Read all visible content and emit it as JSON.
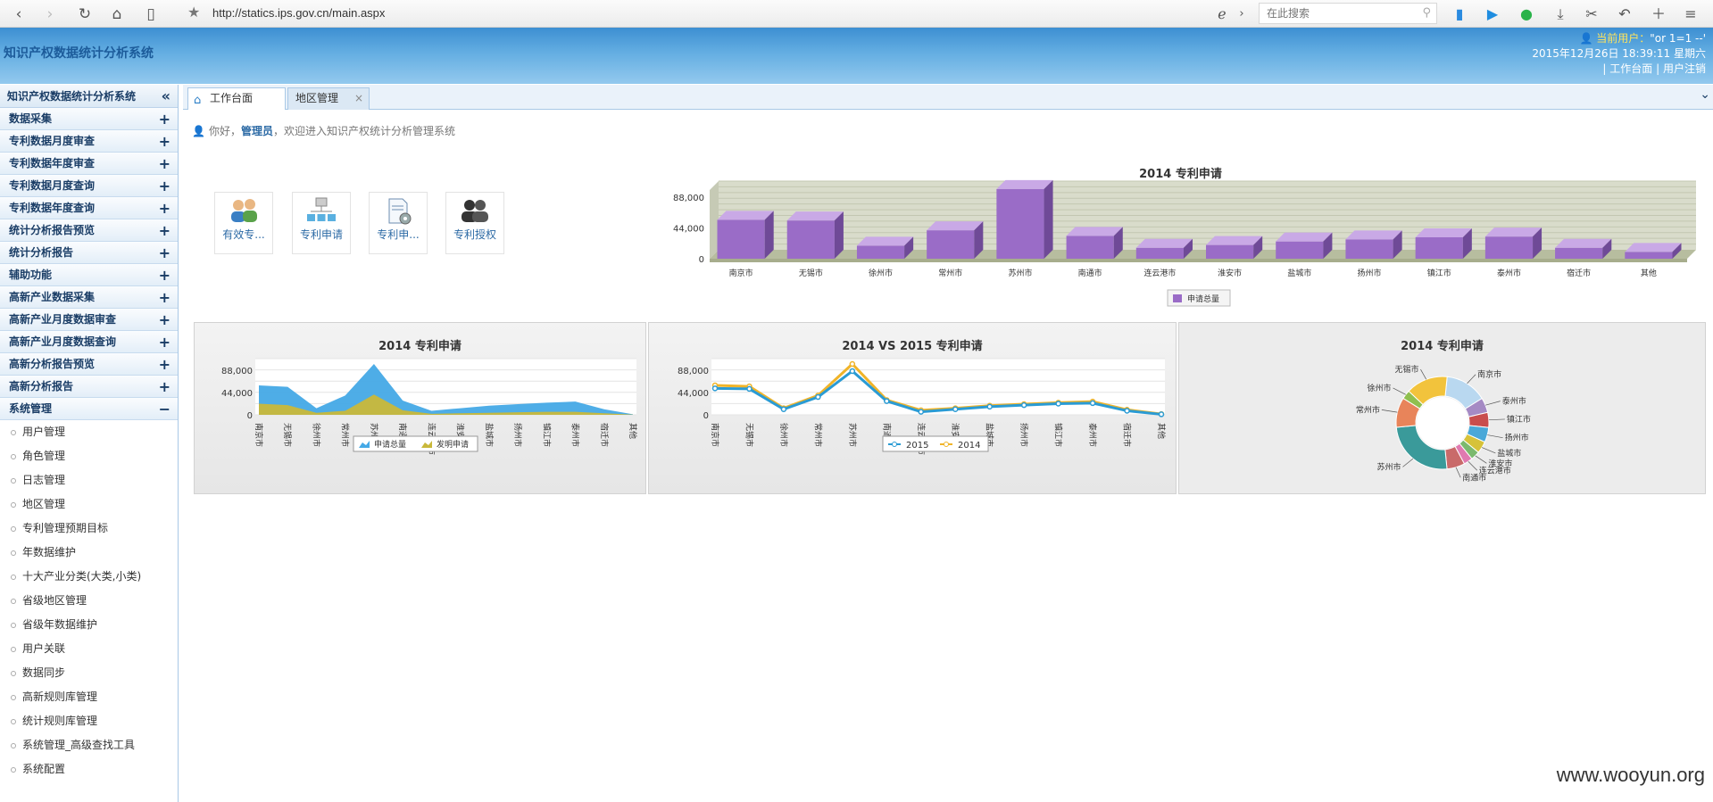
{
  "browser": {
    "url": "http://statics.ips.gov.cn/main.aspx",
    "search_placeholder": "在此搜索"
  },
  "header": {
    "title": "知识产权数据统计分析系统",
    "user_label": "当前用户：",
    "user_value": "\"or 1=1 --'",
    "datetime": "2015年12月26日 18:39:11 星期六",
    "link_home": "工作台面",
    "link_logout": "用户注销",
    "sep": "|"
  },
  "sidebar": {
    "title": "知识产权数据统计分析系统",
    "groups": [
      {
        "label": "数据采集",
        "sign": "+"
      },
      {
        "label": "专利数据月度审查",
        "sign": "+"
      },
      {
        "label": "专利数据年度审查",
        "sign": "+"
      },
      {
        "label": "专利数据月度查询",
        "sign": "+"
      },
      {
        "label": "专利数据年度查询",
        "sign": "+"
      },
      {
        "label": "统计分析报告预览",
        "sign": "+"
      },
      {
        "label": "统计分析报告",
        "sign": "+"
      },
      {
        "label": "辅助功能",
        "sign": "+"
      },
      {
        "label": "高新产业数据采集",
        "sign": "+"
      },
      {
        "label": "高新产业月度数据审查",
        "sign": "+"
      },
      {
        "label": "高新产业月度数据查询",
        "sign": "+"
      },
      {
        "label": "高新分析报告预览",
        "sign": "+"
      },
      {
        "label": "高新分析报告",
        "sign": "+"
      },
      {
        "label": "系统管理",
        "sign": "−"
      }
    ],
    "sub_items": [
      "用户管理",
      "角色管理",
      "日志管理",
      "地区管理",
      "专利管理预期目标",
      "年数据维护",
      "十大产业分类(大类,小类)",
      "省级地区管理",
      "省级年数据维护",
      "用户关联",
      "数据同步",
      "高新规则库管理",
      "统计规则库管理",
      "系统管理_高级查找工具",
      "系统配置"
    ]
  },
  "tabs": {
    "home": "工作台面",
    "region": "地区管理",
    "close": "×"
  },
  "welcome": {
    "prefix": "你好，",
    "user": "管理员",
    "suffix": "，欢迎进入知识产权统计分析管理系统"
  },
  "shortcuts": [
    {
      "label": "有效专...",
      "icon": "users-icon"
    },
    {
      "label": "专利申请",
      "icon": "org-chart-icon"
    },
    {
      "label": "专利申...",
      "icon": "document-gear-icon"
    },
    {
      "label": "专利授权",
      "icon": "group-icon"
    }
  ],
  "colors": {
    "bar": "#9a6cc7",
    "area_total": "#45a9e6",
    "area_invent": "#c9b83a",
    "line_2015": "#2a9bd4",
    "line_2014": "#f0b429"
  },
  "chart_data": [
    {
      "type": "bar",
      "title": "2014 专利申请",
      "categories": [
        "南京市",
        "无锡市",
        "徐州市",
        "常州市",
        "苏州市",
        "南通市",
        "连云港市",
        "淮安市",
        "盐城市",
        "扬州市",
        "镇江市",
        "泰州市",
        "宿迁市",
        "其他"
      ],
      "series": [
        {
          "name": "申请总量",
          "values": [
            48000,
            47000,
            11000,
            33000,
            92000,
            25000,
            8000,
            12000,
            17000,
            20000,
            23000,
            24000,
            8000,
            2000
          ]
        }
      ],
      "ylim": [
        0,
        88000
      ],
      "yticks": [
        0,
        44000,
        88000
      ],
      "ytick_labels": [
        "0",
        "44,000",
        "88,000"
      ],
      "legend": "bottom"
    },
    {
      "type": "area",
      "title": "2014 专利申请",
      "categories": [
        "南京市",
        "无锡市",
        "徐州市",
        "常州市",
        "苏州市",
        "南通市",
        "连云港市",
        "淮安市",
        "盐城市",
        "扬州市",
        "镇江市",
        "泰州市",
        "宿迁市",
        "其他"
      ],
      "series": [
        {
          "name": "申请总量",
          "values": [
            58000,
            55000,
            13000,
            38000,
            100000,
            28000,
            8000,
            13000,
            18000,
            21000,
            24000,
            26000,
            11000,
            1000
          ]
        },
        {
          "name": "发明申请",
          "values": [
            22000,
            19000,
            4000,
            8000,
            40000,
            9000,
            2000,
            3000,
            4000,
            5000,
            6000,
            6000,
            3000,
            500
          ]
        }
      ],
      "ylim": [
        0,
        88000
      ],
      "yticks": [
        0,
        44000,
        88000
      ],
      "ytick_labels": [
        "0",
        "44,000",
        "88,000"
      ],
      "legend": "bottom"
    },
    {
      "type": "line",
      "title": "2014 VS 2015 专利申请",
      "categories": [
        "南京市",
        "无锡市",
        "徐州市",
        "常州市",
        "苏州市",
        "南通市",
        "连云港市",
        "淮安市",
        "盐城市",
        "扬州市",
        "镇江市",
        "泰州市",
        "宿迁市",
        "其他"
      ],
      "series": [
        {
          "name": "2015",
          "values": [
            52000,
            51000,
            11000,
            35000,
            86000,
            27000,
            6000,
            11000,
            16000,
            19000,
            22000,
            23000,
            8000,
            1000
          ]
        },
        {
          "name": "2014",
          "values": [
            58000,
            56000,
            13000,
            38000,
            100000,
            29000,
            9000,
            13000,
            18000,
            21000,
            24000,
            26000,
            10000,
            1500
          ]
        }
      ],
      "ylim": [
        0,
        88000
      ],
      "yticks": [
        0,
        44000,
        88000
      ],
      "ytick_labels": [
        "0",
        "44,000",
        "88,000"
      ],
      "legend": "bottom"
    },
    {
      "type": "pie",
      "title": "2014 专利申请",
      "labels": [
        "南京市",
        "泰州市",
        "镇江市",
        "扬州市",
        "盐城市",
        "淮安市",
        "连云港市",
        "南通市",
        "苏州市",
        "常州市",
        "徐州市",
        "无锡市"
      ],
      "values": [
        14,
        5,
        5,
        5,
        4,
        3,
        3,
        6,
        24,
        10,
        3,
        14
      ],
      "colors": [
        "#b9d8f0",
        "#a58ac4",
        "#c94d4d",
        "#4aa8d8",
        "#d6c23a",
        "#7cb96e",
        "#e07ab0",
        "#c96a6a",
        "#3a9a9a",
        "#e8845a",
        "#8fbf4f",
        "#f2c33c"
      ]
    }
  ],
  "watermark": "www.wooyun.org"
}
